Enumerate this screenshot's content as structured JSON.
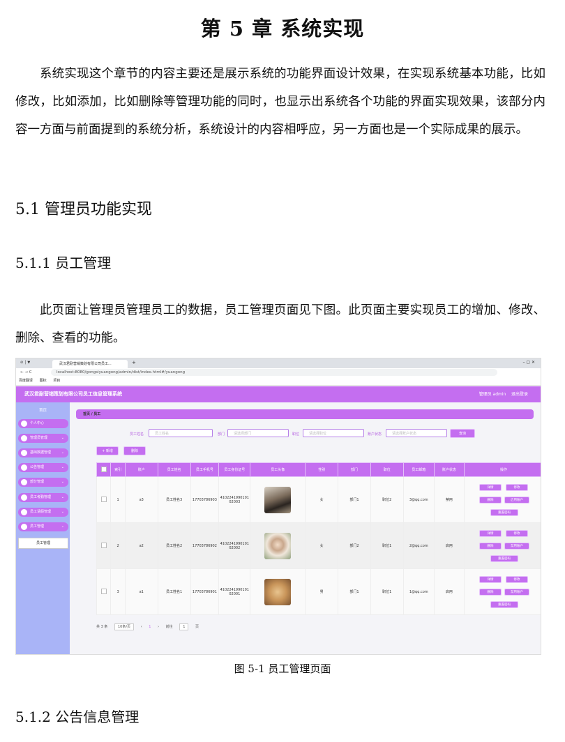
{
  "chapter_title": "第 5 章  系统实现",
  "intro_paragraph": "系统实现这个章节的内容主要还是展示系统的功能界面设计效果，在实现系统基本功能，比如修改，比如添加，比如删除等管理功能的同时，也显示出系统各个功能的界面实现效果，该部分内容一方面与前面提到的系统分析，系统设计的内容相呼应，另一方面也是一个实际成果的展示。",
  "section_5_1": "5.1 管理员功能实现",
  "section_5_1_1": "5.1.1  员工管理",
  "section_5_1_1_paragraph": "此页面让管理员管理员工的数据，员工管理页面见下图。此页面主要实现员工的增加、修改、删除、查看的功能。",
  "figure_caption": "图 5-1  员工管理页面",
  "section_5_1_2": "5.1.2  公告信息管理",
  "screenshot": {
    "browser_tab": "武汉君耐营销策划有限公司员工...",
    "url": "localhost:8080/gongsiyuangong/admin/dist/index.html#/yuangong",
    "bookmarks": [
      "百度翻译",
      "图标",
      "项目"
    ],
    "app_title": "武汉君耐营销策划有限公司员工信息管理系统",
    "header_user": "管理员 admin",
    "header_logout": "退出登录",
    "sidebar_home": "首页",
    "sidebar_items": [
      "个人中心",
      "管理员管理",
      "基础数据管理",
      "公告管理",
      "部分管理",
      "员工考勤管理",
      "员工请假管理",
      "员工管理"
    ],
    "sidebar_sub": "员工管理",
    "breadcrumb": "首页 / 员工",
    "search": {
      "name_label": "员工姓名",
      "name_placeholder": "员工姓名",
      "dept_label": "部门",
      "dept_placeholder": "请选择部门",
      "post_label": "职位",
      "post_placeholder": "请选择职位",
      "status_label": "账户状态",
      "status_placeholder": "请选择账户状态",
      "query_button": "查询"
    },
    "add_button": "+ 新增",
    "delete_button": "删除",
    "columns": [
      "",
      "索引",
      "账户",
      "员工姓名",
      "员工手机号",
      "员工身份证号",
      "员工头像",
      "性别",
      "部门",
      "职位",
      "员工邮箱",
      "账户状态",
      "操作"
    ],
    "rows": [
      {
        "index": "1",
        "account": "a3",
        "name": "员工姓名3",
        "phone": "17703786903",
        "idcard": "410224199010102003",
        "gender": "女",
        "dept": "部门1",
        "post": "职位2",
        "email": "3@qq.com",
        "status": "禁用"
      },
      {
        "index": "2",
        "account": "a2",
        "name": "员工姓名2",
        "phone": "17703786902",
        "idcard": "410224199010102002",
        "gender": "女",
        "dept": "部门2",
        "post": "职位1",
        "email": "2@qq.com",
        "status": "启用"
      },
      {
        "index": "3",
        "account": "a1",
        "name": "员工姓名1",
        "phone": "17703786901",
        "idcard": "410224199010102001",
        "gender": "男",
        "dept": "部门1",
        "post": "职位1",
        "email": "1@qq.com",
        "status": "启用"
      }
    ],
    "op_buttons": [
      "详情",
      "修改",
      "删除",
      "启用账户",
      "重置密码"
    ],
    "op_buttons_row2": [
      "详情",
      "修改",
      "删除",
      "禁用账户",
      "重置密码"
    ],
    "pager": {
      "total": "共 3 条",
      "per_page": "10条/页",
      "page": "1",
      "goto": "前往",
      "goto_page": "1",
      "goto_unit": "页"
    },
    "colors": {
      "accent": "#c46ef0",
      "sidebar": "#a9b4f7"
    }
  }
}
